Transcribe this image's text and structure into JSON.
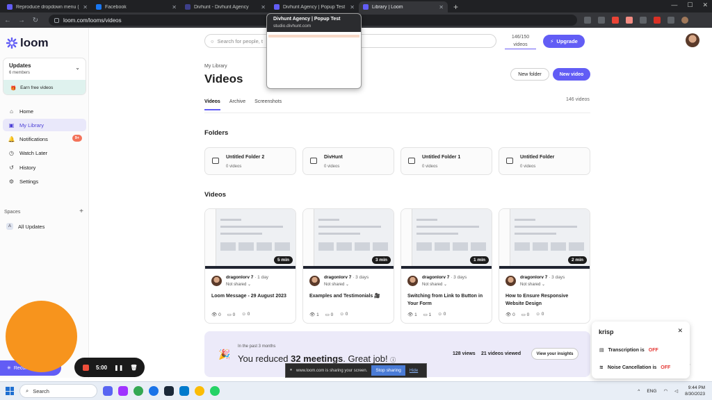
{
  "browser": {
    "tabs": [
      {
        "title": "Reproduce dropdown menu (no...",
        "color": "#625df5"
      },
      {
        "title": "Facebook",
        "color": "#1877f2"
      },
      {
        "title": "Divhunt - Divhunt Agency",
        "color": "#3d3f8a"
      },
      {
        "title": "Divhunt Agency | Popup Test",
        "color": "#625df5"
      },
      {
        "title": "Library | Loom",
        "color": "#625df5"
      }
    ],
    "url": "loom.com/looms/videos"
  },
  "tab_preview": {
    "title": "Divhunt Agency | Popup Test",
    "url": "studio.divhunt.com"
  },
  "sidebar": {
    "brand": "loom",
    "workspace": {
      "name": "Updates",
      "members": "6 members",
      "earn": "Earn free videos"
    },
    "nav": [
      {
        "label": "Home",
        "icon": "home-icon"
      },
      {
        "label": "My Library",
        "icon": "library-icon",
        "active": true
      },
      {
        "label": "Notifications",
        "icon": "bell-icon",
        "badge": "9+"
      },
      {
        "label": "Watch Later",
        "icon": "clock-icon"
      },
      {
        "label": "History",
        "icon": "history-icon"
      },
      {
        "label": "Settings",
        "icon": "gear-icon"
      }
    ],
    "spaces_label": "Spaces",
    "all_updates": "All Updates",
    "all_updates_initial": "A"
  },
  "header": {
    "search_placeholder": "Search for people, t",
    "usage": "146/150",
    "usage_label": "videos",
    "upgrade": "Upgrade"
  },
  "library": {
    "breadcrumb": "My Library",
    "title": "Videos",
    "new_folder": "New folder",
    "new_video": "New video",
    "tabs": [
      "Videos",
      "Archive",
      "Screenshots"
    ],
    "count": "146 videos",
    "folders_heading": "Folders",
    "folders": [
      {
        "name": "Untitled Folder 2",
        "count": "0 videos"
      },
      {
        "name": "DivHunt",
        "count": "0 videos"
      },
      {
        "name": "Untitled Folder 1",
        "count": "0 videos"
      },
      {
        "name": "Untitled Folder",
        "count": "0 videos"
      }
    ],
    "videos_heading": "Videos",
    "videos": [
      {
        "duration": "5 min",
        "author": "dragonlorv 7",
        "age": "· 1 day",
        "share": "Not shared",
        "title": "Loom Message - 29 August 2023",
        "views": "0",
        "comments": "0",
        "reactions": "0"
      },
      {
        "duration": "3 min",
        "author": "dragonlorv 7",
        "age": "· 3 days",
        "share": "Not shared",
        "title": "Examples and Testimonials 🎥",
        "views": "1",
        "comments": "0",
        "reactions": "0"
      },
      {
        "duration": "1 min",
        "author": "dragonlorv 7",
        "age": "· 3 days",
        "share": "Not shared",
        "title": "Switching from Link to Button in Your Form",
        "views": "1",
        "comments": "1",
        "reactions": "0"
      },
      {
        "duration": "2 min",
        "author": "dragonlorv 7",
        "age": "· 3 days",
        "share": "Not shared",
        "title": "How to Ensure Responsive Website Design",
        "views": "0",
        "comments": "0",
        "reactions": "0"
      }
    ]
  },
  "insight": {
    "period": "In the past 3 months",
    "message_pre": "You reduced ",
    "message_bold": "32 meetings",
    "message_post": ". Great job!",
    "views": "128 views",
    "viewed": "21 videos viewed",
    "button": "View your insights"
  },
  "recorder": {
    "label": "Recor",
    "time": "5:00"
  },
  "share_bar": {
    "text": "www.loom.com is sharing your screen.",
    "stop": "Stop sharing",
    "hide": "Hide"
  },
  "krisp": {
    "title": "krisp",
    "transcription_label": "Transcription is",
    "transcription_state": "OFF",
    "noise_label": "Noise Cancellation is",
    "noise_state": "OFF"
  },
  "taskbar": {
    "search": "Search",
    "lang": "ENG",
    "time": "9:44 PM",
    "date": "8/30/2023"
  },
  "colors": {
    "accent": "#625df5",
    "recorder": "#f7941d",
    "badge": "#f3735a"
  }
}
